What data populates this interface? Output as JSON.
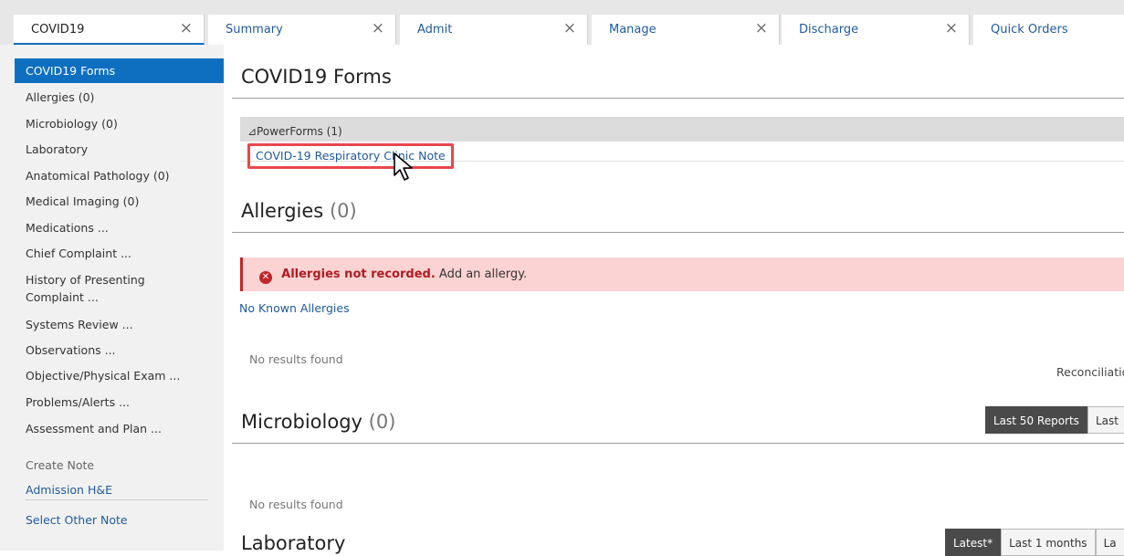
{
  "tabs": [
    {
      "label": "COVID19",
      "active": true
    },
    {
      "label": "Summary",
      "active": false
    },
    {
      "label": "Admit",
      "active": false
    },
    {
      "label": "Manage",
      "active": false
    },
    {
      "label": "Discharge",
      "active": false
    },
    {
      "label": "Quick Orders",
      "active": false
    }
  ],
  "tab_close_glyph": "×",
  "sidebar": {
    "items": [
      {
        "label": "COVID19 Forms"
      },
      {
        "label": "Allergies (0)"
      },
      {
        "label": "Microbiology (0)"
      },
      {
        "label": "Laboratory"
      },
      {
        "label": "Anatomical Pathology (0)"
      },
      {
        "label": "Medical Imaging (0)"
      },
      {
        "label": "Medications ..."
      },
      {
        "label": "Chief Complaint ..."
      },
      {
        "label": "History of Presenting Complaint ..."
      },
      {
        "label": "Systems Review ..."
      },
      {
        "label": "Observations ..."
      },
      {
        "label": "Objective/Physical Exam ..."
      },
      {
        "label": "Problems/Alerts ..."
      },
      {
        "label": "Assessment and Plan ..."
      }
    ],
    "create_note_heading": "Create Note",
    "note_links": [
      "Admission H&E",
      "Select Other Note"
    ]
  },
  "main": {
    "covid_forms": {
      "title": "COVID19 Forms",
      "powerforms_label": "⊿PowerForms (1)",
      "form_link": "COVID-19 Respiratory Clinic Note"
    },
    "allergies": {
      "title": "Allergies",
      "count": "(0)",
      "alert_strong": "Allergies not recorded.",
      "alert_text": "Add an allergy.",
      "nka_link": "No Known Allergies",
      "no_results": "No results found",
      "reconciliation": "Reconciliatio"
    },
    "microbiology": {
      "title": "Microbiology",
      "count": "(0)",
      "no_results": "No results found",
      "filters": [
        "Last 50 Reports",
        "Last"
      ]
    },
    "laboratory": {
      "title": "Laboratory",
      "filters": [
        "Latest*",
        "Last 1 months",
        "La"
      ]
    }
  },
  "colors": {
    "accent": "#0e6fc1",
    "link": "#1f5a9e",
    "alert_bg": "#fcd3d3",
    "alert_red": "#c0262a",
    "highlight_box": "#e8474c"
  }
}
